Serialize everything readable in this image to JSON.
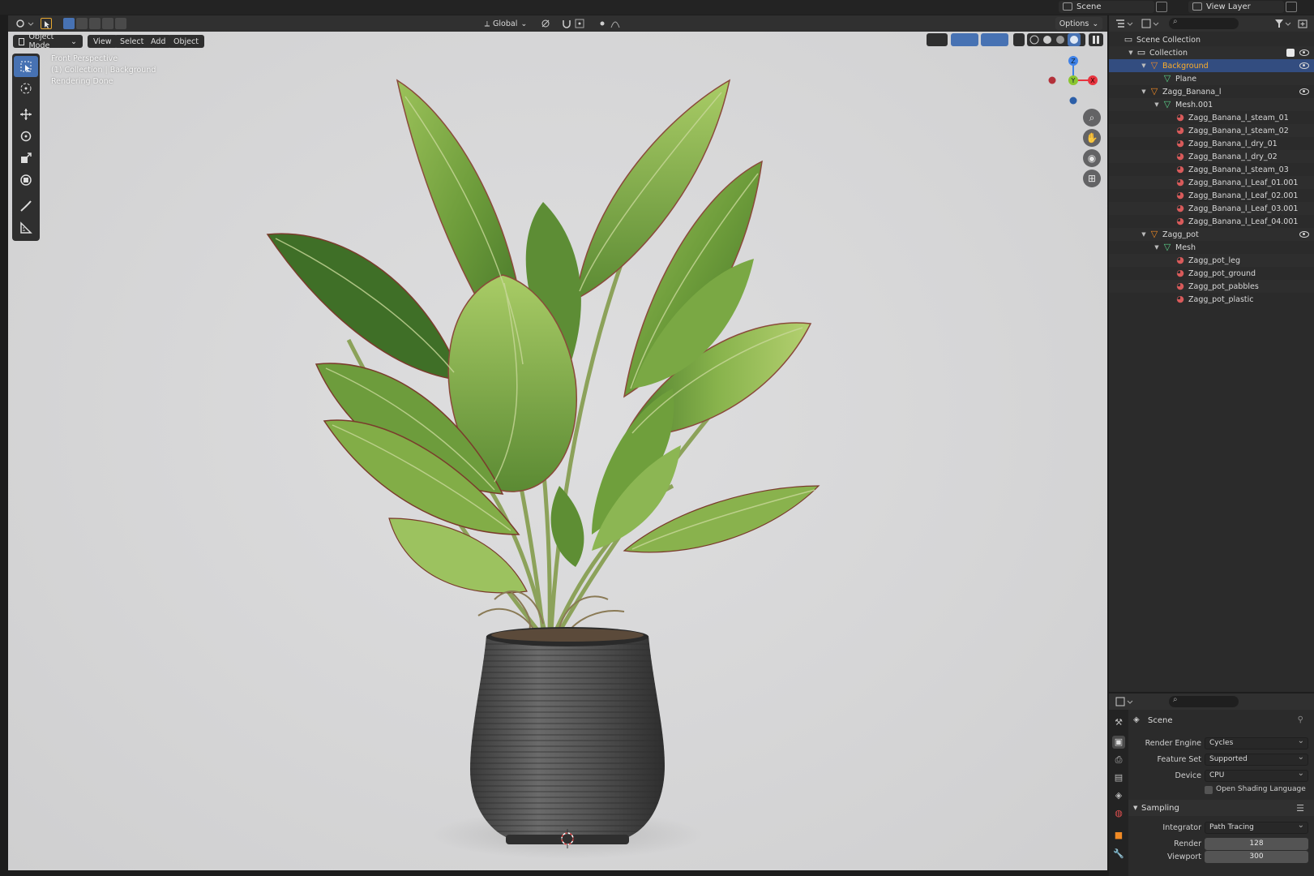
{
  "topbar": {
    "scene_label": "Scene",
    "view_layer_label": "View Layer"
  },
  "viewport_header": {
    "transform_orientation": "Global",
    "options_label": "Options"
  },
  "viewport": {
    "mode_label": "Object Mode",
    "menus": [
      "View",
      "Select",
      "Add",
      "Object"
    ],
    "info_lines": [
      "Front Perspective",
      "(1) Collection | Background",
      "Rendering Done"
    ],
    "gizmo_axes": [
      "Z",
      "Y",
      "X"
    ]
  },
  "outliner": {
    "rows": [
      {
        "label": "Scene Collection",
        "icon": "scene-collection-icon",
        "depth": 0,
        "arrow": "",
        "eye": false,
        "selected": false
      },
      {
        "label": "Collection",
        "icon": "collection-icon",
        "depth": 1,
        "arrow": "▼",
        "eye": true,
        "selected": false
      },
      {
        "label": "Background",
        "icon": "object-icon",
        "depth": 2,
        "arrow": "▼",
        "eye": true,
        "selected": true
      },
      {
        "label": "Plane",
        "icon": "mesh-data-icon",
        "depth": 3,
        "arrow": "",
        "eye": false,
        "selected": false
      },
      {
        "label": "Zagg_Banana_l",
        "icon": "object-icon",
        "depth": 2,
        "arrow": "▼",
        "eye": true,
        "selected": false
      },
      {
        "label": "Mesh.001",
        "icon": "mesh-data-icon",
        "depth": 3,
        "arrow": "▼",
        "eye": false,
        "selected": false
      },
      {
        "label": "Zagg_Banana_l_steam_01",
        "icon": "material-icon",
        "depth": 4,
        "arrow": "",
        "eye": false,
        "selected": false
      },
      {
        "label": "Zagg_Banana_l_steam_02",
        "icon": "material-icon",
        "depth": 4,
        "arrow": "",
        "eye": false,
        "selected": false
      },
      {
        "label": "Zagg_Banana_l_dry_01",
        "icon": "material-icon",
        "depth": 4,
        "arrow": "",
        "eye": false,
        "selected": false
      },
      {
        "label": "Zagg_Banana_l_dry_02",
        "icon": "material-icon",
        "depth": 4,
        "arrow": "",
        "eye": false,
        "selected": false
      },
      {
        "label": "Zagg_Banana_l_steam_03",
        "icon": "material-icon",
        "depth": 4,
        "arrow": "",
        "eye": false,
        "selected": false
      },
      {
        "label": "Zagg_Banana_l_Leaf_01.001",
        "icon": "material-icon",
        "depth": 4,
        "arrow": "",
        "eye": false,
        "selected": false
      },
      {
        "label": "Zagg_Banana_l_Leaf_02.001",
        "icon": "material-icon",
        "depth": 4,
        "arrow": "",
        "eye": false,
        "selected": false
      },
      {
        "label": "Zagg_Banana_l_Leaf_03.001",
        "icon": "material-icon",
        "depth": 4,
        "arrow": "",
        "eye": false,
        "selected": false
      },
      {
        "label": "Zagg_Banana_l_Leaf_04.001",
        "icon": "material-icon",
        "depth": 4,
        "arrow": "",
        "eye": false,
        "selected": false
      },
      {
        "label": "Zagg_pot",
        "icon": "object-icon",
        "depth": 2,
        "arrow": "▼",
        "eye": true,
        "selected": false
      },
      {
        "label": "Mesh",
        "icon": "mesh-data-icon",
        "depth": 3,
        "arrow": "▼",
        "eye": false,
        "selected": false
      },
      {
        "label": "Zagg_pot_leg",
        "icon": "material-icon",
        "depth": 4,
        "arrow": "",
        "eye": false,
        "selected": false
      },
      {
        "label": "Zagg_pot_ground",
        "icon": "material-icon",
        "depth": 4,
        "arrow": "",
        "eye": false,
        "selected": false
      },
      {
        "label": "Zagg_pot_pabbles",
        "icon": "material-icon",
        "depth": 4,
        "arrow": "",
        "eye": false,
        "selected": false
      },
      {
        "label": "Zagg_pot_plastic",
        "icon": "material-icon",
        "depth": 4,
        "arrow": "",
        "eye": false,
        "selected": false
      }
    ]
  },
  "properties": {
    "context_label": "Scene",
    "render_engine_label": "Render Engine",
    "render_engine_value": "Cycles",
    "feature_set_label": "Feature Set",
    "feature_set_value": "Supported",
    "device_label": "Device",
    "device_value": "CPU",
    "osl_label": "Open Shading Language",
    "sampling_label": "Sampling",
    "integrator_label": "Integrator",
    "integrator_value": "Path Tracing",
    "render_label": "Render",
    "render_value": "128",
    "viewport_label": "Viewport",
    "viewport_value": "300"
  },
  "colors": {
    "selection_blue": "#334d80",
    "active_orange": "#ffaf29",
    "tool_active": "#4772b3",
    "axis_x": "#e8343f",
    "axis_y": "#8ac630",
    "axis_z": "#3f82e8"
  }
}
